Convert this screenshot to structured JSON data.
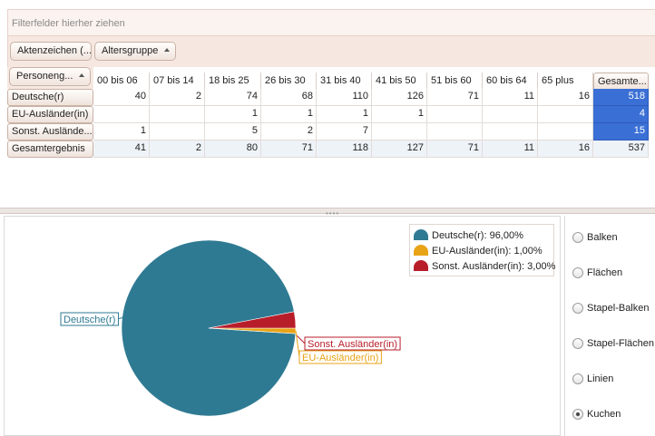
{
  "filter_zone": {
    "hint": "Filterfelder hierher ziehen"
  },
  "column_fields": [
    {
      "label": "Aktenzeichen (...",
      "has_sort_arrow": false
    },
    {
      "label": "Altersgruppe",
      "has_sort_arrow": true
    }
  ],
  "row_field": {
    "label": "Personeng...",
    "has_sort_arrow": true
  },
  "columns": [
    "00 bis 06",
    "07 bis 14",
    "18 bis 25",
    "26 bis 30",
    "31 bis 40",
    "41 bis 50",
    "51 bis 60",
    "60 bis 64",
    "65 plus",
    "Gesamte..."
  ],
  "rows": [
    {
      "label": "Deutsche(r)",
      "values": [
        "40",
        "2",
        "74",
        "68",
        "110",
        "126",
        "71",
        "11",
        "16",
        "518"
      ]
    },
    {
      "label": "EU-Ausländer(in)",
      "values": [
        "",
        "",
        "1",
        "1",
        "1",
        "1",
        "",
        "",
        "",
        "4"
      ]
    },
    {
      "label": "Sonst. Auslände...",
      "values": [
        "1",
        "",
        "5",
        "2",
        "7",
        "",
        "",
        "",
        "",
        "15"
      ]
    },
    {
      "label": "Gesamtergebnis",
      "values": [
        "41",
        "2",
        "80",
        "71",
        "118",
        "127",
        "71",
        "11",
        "16",
        "537"
      ]
    }
  ],
  "chart_data": {
    "type": "pie",
    "slices": [
      {
        "label": "Deutsche(r)",
        "value": 96.0,
        "color": "#2f7a93"
      },
      {
        "label": "EU-Ausländer(in)",
        "value": 1.0,
        "color": "#e8a317"
      },
      {
        "label": "Sonst. Ausländer(in)",
        "value": 3.0,
        "color": "#b81e2a"
      }
    ],
    "legend": [
      "Deutsche(r): 96,00%",
      "EU-Ausländer(in): 1,00%",
      "Sonst. Ausländer(in): 3,00%"
    ],
    "legend_position": "top-right",
    "data_labels": [
      "Deutsche(r)",
      "Sonst. Ausländer(in)",
      "EU-Ausländer(in)"
    ]
  },
  "chart_types": {
    "options": [
      "Balken",
      "Flächen",
      "Stapel-Balken",
      "Stapel-Flächen",
      "Linien",
      "Kuchen"
    ],
    "selected": "Kuchen"
  },
  "colors": {
    "selected_total_cell": "#3a6fd6",
    "header_tint": "#f6e8e1"
  }
}
